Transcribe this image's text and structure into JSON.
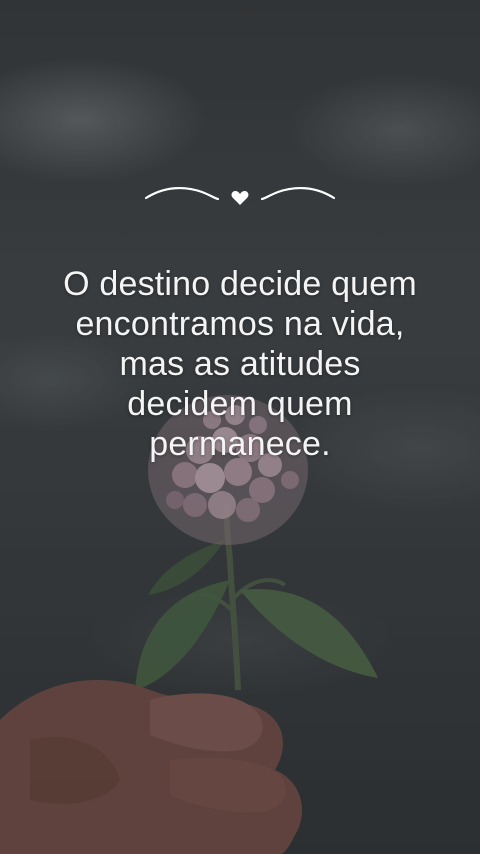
{
  "quote": {
    "lines": [
      "O destino decide quem",
      "encontramos na vida,",
      "mas as atitudes",
      "decidem quem",
      "permanece."
    ]
  },
  "ornament": {
    "icon": "heart-icon",
    "color": "#ffffff"
  },
  "colors": {
    "text": "#f4f4f4",
    "sky": "#3f4346",
    "flower": "#c9aeb8",
    "leaf": "#5d7a55",
    "skin": "#8a5a52"
  }
}
